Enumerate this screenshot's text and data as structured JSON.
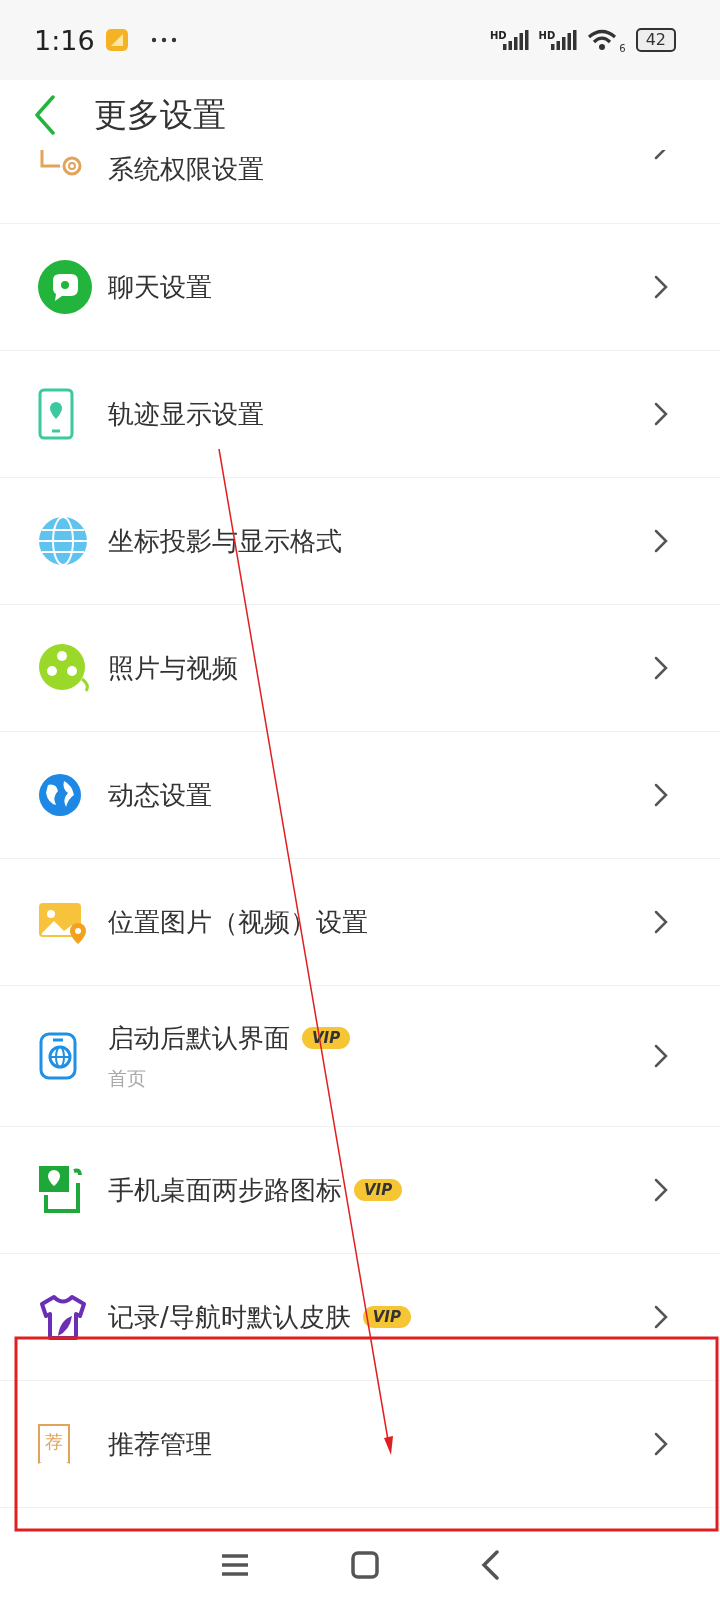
{
  "status_bar": {
    "time": "1:16",
    "sim_labels": [
      "HD",
      "HD"
    ],
    "wifi_label": "6",
    "battery": "42"
  },
  "header": {
    "title": "更多设置"
  },
  "items": [
    {
      "label": "系统权限设置"
    },
    {
      "label": "聊天设置"
    },
    {
      "label": "轨迹显示设置"
    },
    {
      "label": "坐标投影与显示格式"
    },
    {
      "label": "照片与视频"
    },
    {
      "label": "动态设置"
    },
    {
      "label": "位置图片（视频）设置"
    },
    {
      "label": "启动后默认界面",
      "badge": "VIP",
      "subtitle": "首页"
    },
    {
      "label": "手机桌面两步路图标",
      "badge": "VIP"
    },
    {
      "label": "记录/导航时默认皮肤",
      "badge": "VIP"
    },
    {
      "label": "推荐管理",
      "icon_text": "荐"
    }
  ]
}
